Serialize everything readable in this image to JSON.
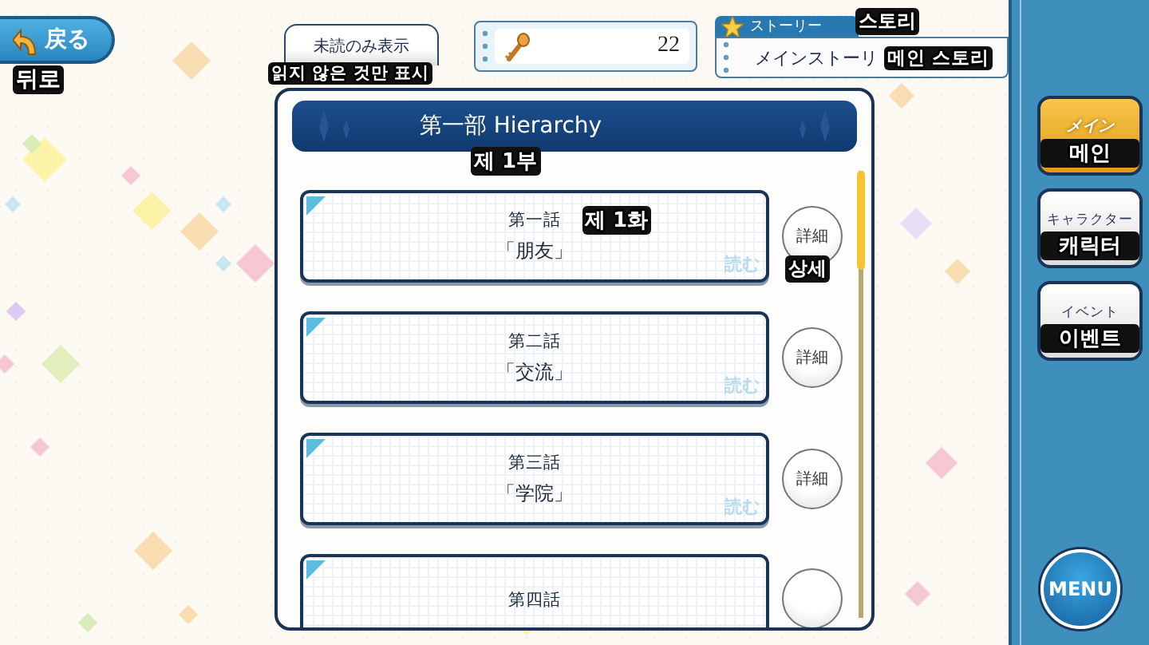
{
  "back_button": {
    "label": "戻る",
    "caption": "뒤로"
  },
  "filter_button": {
    "label": "未読のみ表示",
    "caption": "읽지 않은 것만 표시"
  },
  "key_counter": {
    "value": "22"
  },
  "story_header": {
    "tab": "ストーリー",
    "tab_caption": "스토리",
    "title": "メインストーリ",
    "title_caption": "메인 스토리"
  },
  "chapter": {
    "title": "第一部 Hierarchy",
    "caption": "제 1부"
  },
  "episodes": [
    {
      "number": "第一話",
      "number_caption": "제 1화",
      "title": "「朋友」",
      "stamp": "読む",
      "detail_label": "詳細",
      "detail_caption": "상세"
    },
    {
      "number": "第二話",
      "title": "「交流」",
      "stamp": "読む",
      "detail_label": "詳細"
    },
    {
      "number": "第三話",
      "title": "「学院」",
      "stamp": "読む",
      "detail_label": "詳細"
    },
    {
      "number": "第四話"
    }
  ],
  "category_tabs": [
    {
      "label": "メイン",
      "caption": "메인",
      "selected": true
    },
    {
      "label": "キャラクター",
      "caption": "캐릭터",
      "selected": false
    },
    {
      "label": "イベント",
      "caption": "이벤트",
      "selected": false
    }
  ],
  "menu_button": {
    "label": "MENU"
  }
}
